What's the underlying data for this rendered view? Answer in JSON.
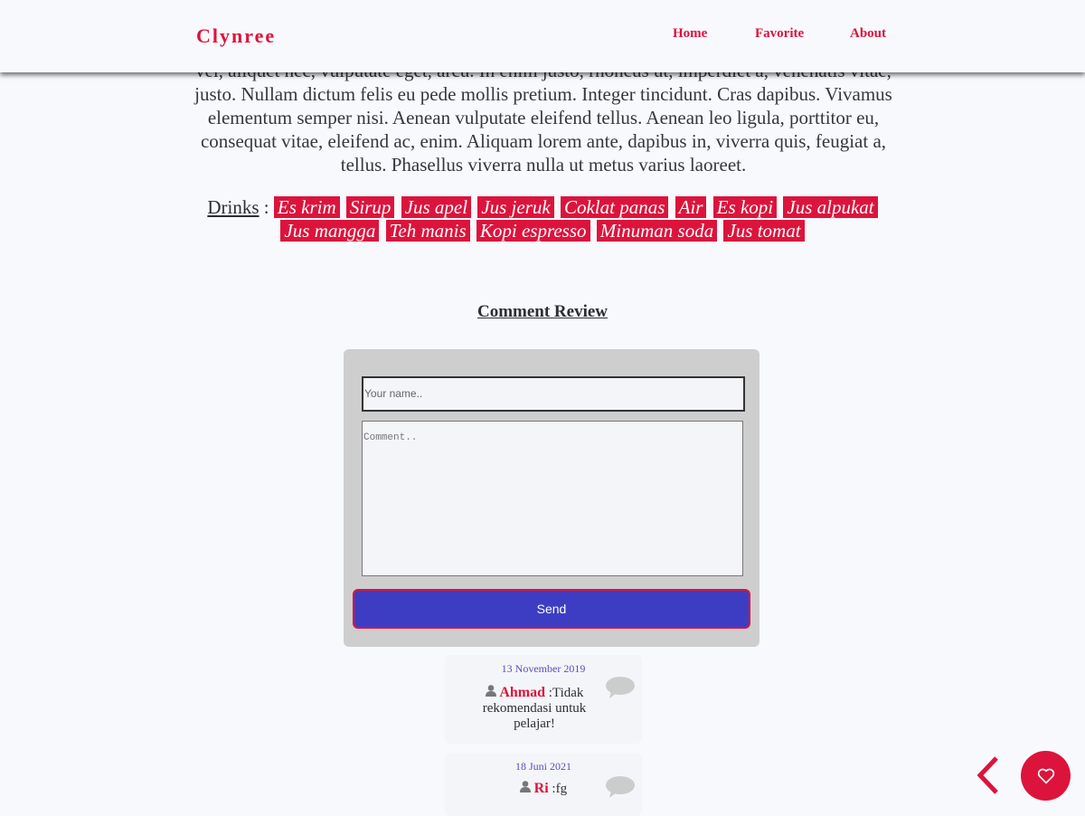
{
  "header": {
    "logo": "Clynree",
    "nav": [
      "Home",
      "Favorite",
      "About"
    ]
  },
  "article": {
    "paragraph": "vel, aliquet nec, vulputate eget, arcu. In enim justo, rhoncus ut, imperdiet a, venenatis vitae, justo. Nullam dictum felis eu pede mollis pretium. Integer tincidunt. Cras dapibus. Vivamus elementum semper nisi. Aenean vulputate eleifend tellus. Aenean leo ligula, porttitor eu, consequat vitae, eleifend ac, enim. Aliquam lorem ante, dapibus in, viverra quis, feugiat a, tellus. Phasellus viverra nulla ut metus varius laoreet.",
    "drinks_label": "Drinks",
    "drinks_sep": " : ",
    "drinks": [
      "Es krim",
      "Sirup",
      "Jus apel",
      "Jus jeruk",
      "Coklat panas",
      "Air",
      "Es kopi",
      "Jus alpukat",
      "Jus mangga",
      "Teh manis",
      "Kopi espresso",
      "Minuman soda",
      "Jus tomat"
    ]
  },
  "comments_section": {
    "title": "Comment Review",
    "name_placeholder": "Your name..",
    "comment_placeholder": "Comment..",
    "send_label": "Send"
  },
  "comments": [
    {
      "date": "13 November 2019",
      "author": "Ahmad",
      "text": " :Tidak rekomendasi untuk pelajar!"
    },
    {
      "date": "18 Juni 2021",
      "author": "Ri",
      "text": " :fg"
    }
  ],
  "colors": {
    "accent": "#dc143c",
    "button": "#3d3dc4"
  }
}
